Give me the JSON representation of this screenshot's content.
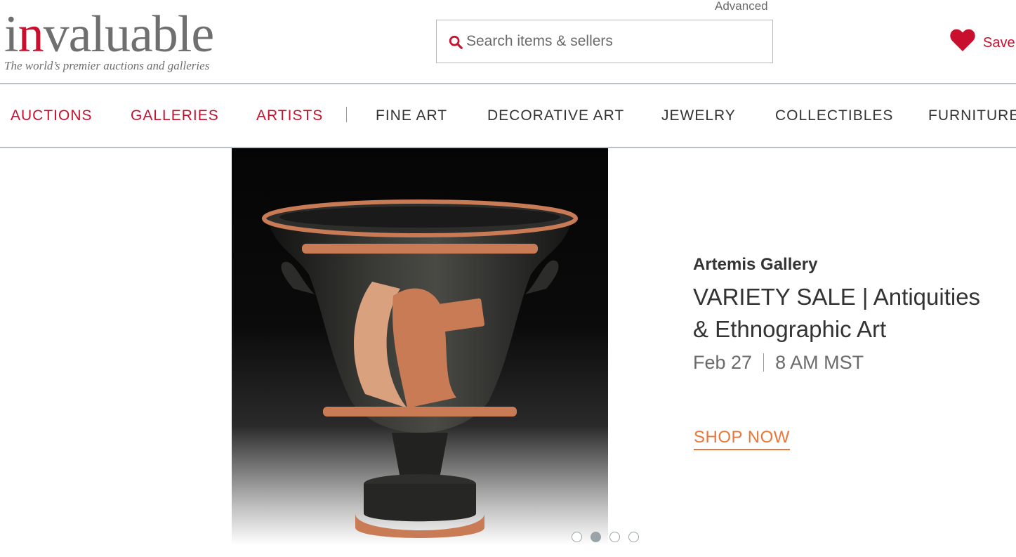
{
  "brand": {
    "logo_pre": "i",
    "logo_red": "n",
    "logo_post": "valuable",
    "tagline": "The world’s premier auctions and galleries",
    "accent_color": "#c8102e"
  },
  "search": {
    "advanced_label": "Advanced",
    "placeholder": "Search items & sellers",
    "value": "",
    "icon": "search-icon"
  },
  "header": {
    "save_label": "Save",
    "save_icon": "heart-icon"
  },
  "nav": {
    "primary": [
      {
        "label": "AUCTIONS"
      },
      {
        "label": "GALLERIES"
      },
      {
        "label": "ARTISTS"
      }
    ],
    "categories": [
      {
        "label": "FINE ART"
      },
      {
        "label": "DECORATIVE ART"
      },
      {
        "label": "JEWELRY"
      },
      {
        "label": "COLLECTIBLES"
      },
      {
        "label": "FURNITURE"
      }
    ]
  },
  "hero": {
    "seller": "Artemis Gallery",
    "title_line1": "VARIETY SALE | Antiquities",
    "title_line2": "& Ethnographic Art",
    "date": "Feb 27",
    "time": "8 AM MST",
    "cta": "SHOP NOW",
    "cta_color": "#e8773a",
    "carousel": {
      "count": 4,
      "active_index": 1
    }
  }
}
